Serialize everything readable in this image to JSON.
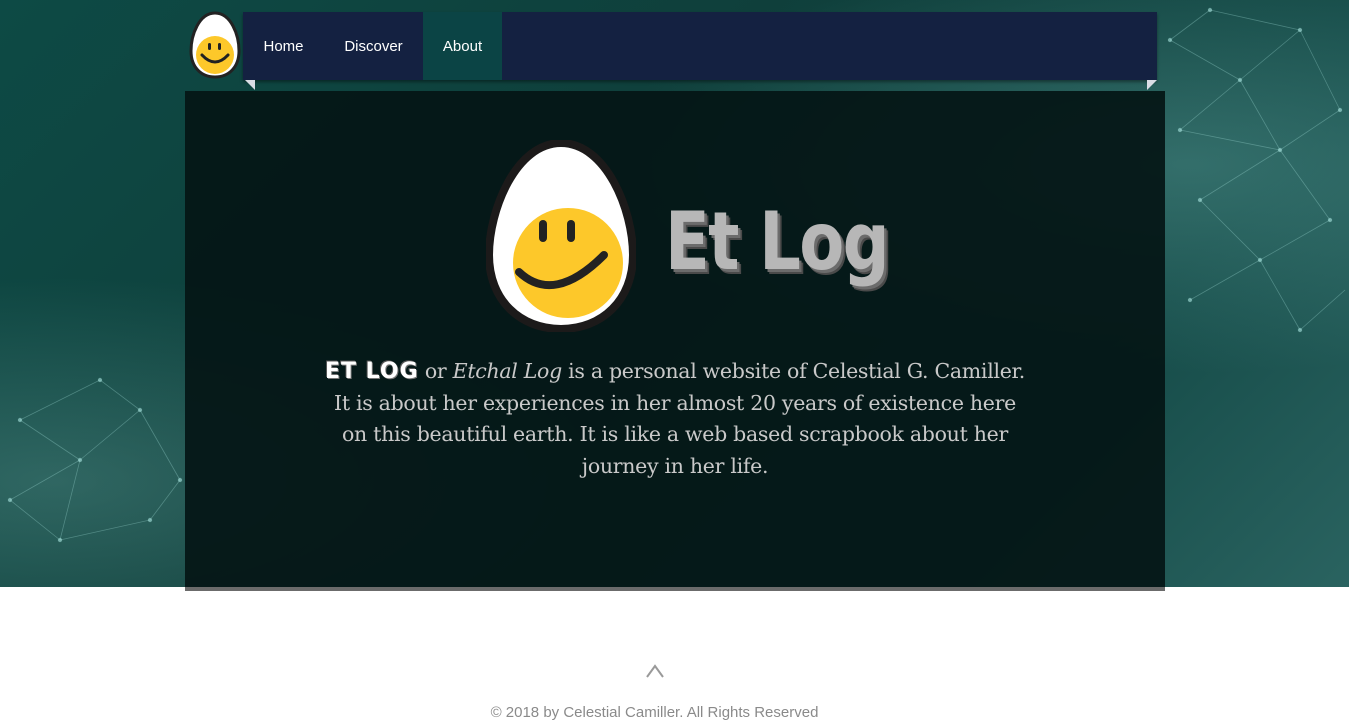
{
  "nav": {
    "items": [
      {
        "label": "Home",
        "active": false
      },
      {
        "label": "Discover",
        "active": false
      },
      {
        "label": "About",
        "active": true
      }
    ]
  },
  "hero": {
    "title": "Et Log",
    "description": {
      "brand": "ET LOG",
      "connector": "or",
      "alt_name": "Etchal Log",
      "body": "is a personal website of Celestial G. Camiller. It is about her experiences in her almost 20 years of existence here on this beautiful earth.  It is like a web based scrapbook about her journey in her life."
    }
  },
  "footer": {
    "scroll_up_glyph": "^",
    "copyright": "© 2018 by Celestial Camiller. All Rights Reserved"
  },
  "colors": {
    "nav_bg": "#142141",
    "nav_active_bg": "#0b4445",
    "panel_bg": "#041616",
    "egg_yolk": "#fdc82a",
    "page_bg": "#0f3f3b"
  },
  "icons": [
    "egg-smiley-logo-icon",
    "chevron-up-icon"
  ]
}
